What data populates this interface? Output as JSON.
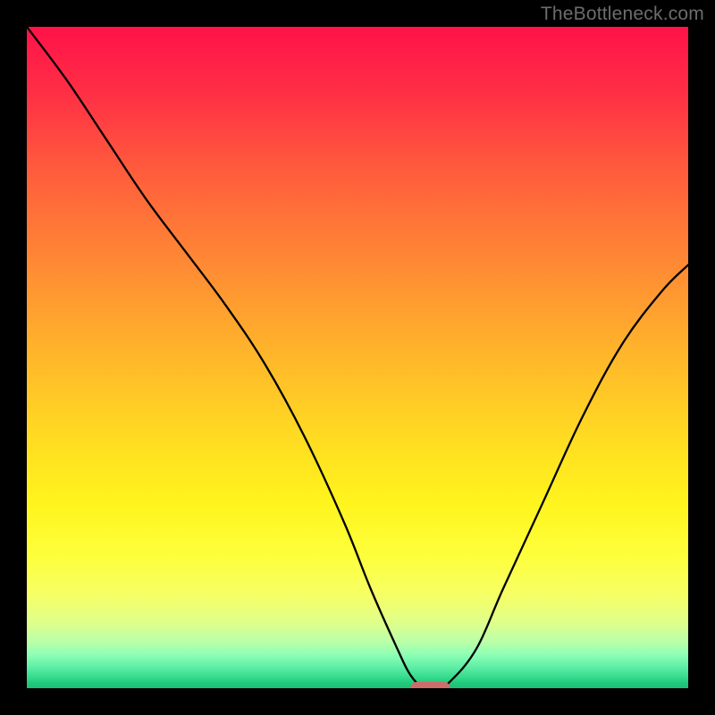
{
  "watermark": "TheBottleneck.com",
  "chart_data": {
    "type": "line",
    "title": "",
    "xlabel": "",
    "ylabel": "",
    "xlim": [
      0,
      100
    ],
    "ylim": [
      0,
      100
    ],
    "grid": false,
    "legend": false,
    "series": [
      {
        "name": "bottleneck-curve",
        "x": [
          0,
          6,
          12,
          18,
          24,
          30,
          36,
          42,
          48,
          52,
          56,
          58,
          60,
          62,
          64,
          68,
          72,
          78,
          84,
          90,
          96,
          100
        ],
        "y": [
          100,
          92,
          83,
          74,
          66,
          58,
          49,
          38,
          25,
          15,
          6,
          2,
          0,
          0,
          1,
          6,
          15,
          28,
          41,
          52,
          60,
          64
        ]
      }
    ],
    "marker": {
      "name": "optimal-marker",
      "x_range": [
        58,
        64
      ],
      "y": 0,
      "color": "#ce6c6c"
    },
    "background": {
      "type": "vertical-gradient",
      "stops": [
        {
          "pos": 0.0,
          "color": "#ff1249"
        },
        {
          "pos": 0.1,
          "color": "#ff2f45"
        },
        {
          "pos": 0.22,
          "color": "#ff5d3c"
        },
        {
          "pos": 0.36,
          "color": "#ff8a34"
        },
        {
          "pos": 0.5,
          "color": "#ffb72a"
        },
        {
          "pos": 0.62,
          "color": "#ffdb22"
        },
        {
          "pos": 0.72,
          "color": "#fff41d"
        },
        {
          "pos": 0.8,
          "color": "#fdff3c"
        },
        {
          "pos": 0.86,
          "color": "#f6ff66"
        },
        {
          "pos": 0.9,
          "color": "#e0ff8a"
        },
        {
          "pos": 0.93,
          "color": "#baffa8"
        },
        {
          "pos": 0.95,
          "color": "#8cffb6"
        },
        {
          "pos": 0.97,
          "color": "#5aeba4"
        },
        {
          "pos": 0.985,
          "color": "#30d989"
        },
        {
          "pos": 0.992,
          "color": "#22c97c"
        },
        {
          "pos": 1.0,
          "color": "#1bbf74"
        }
      ]
    }
  }
}
